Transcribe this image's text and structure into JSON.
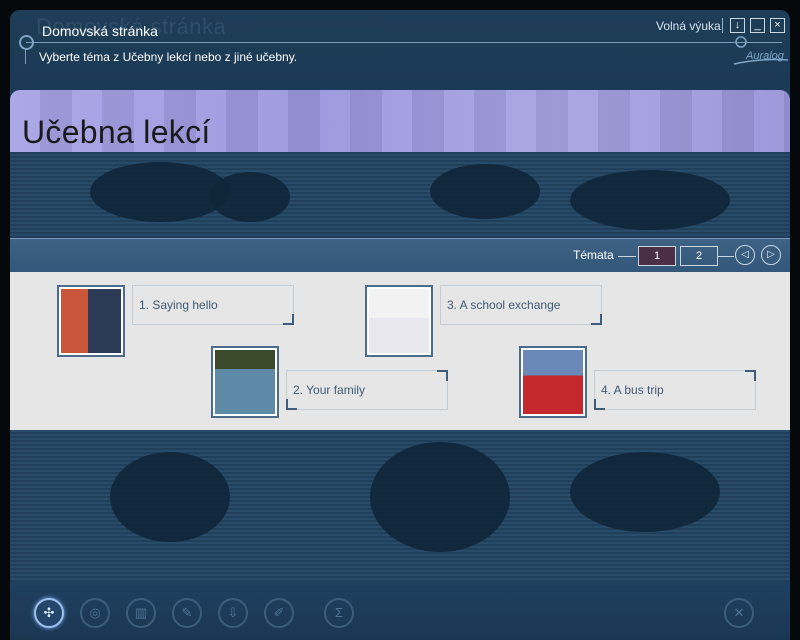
{
  "window": {
    "ghost_title": "Domovská stránka",
    "title": "Domovská stránka",
    "subtitle": "Vyberte téma z Učebny lekcí nebo z jiné učebny.",
    "mode_label": "Volná výuka",
    "buttons": {
      "download": "↓",
      "minimize": "_",
      "close": "×"
    },
    "logo_text": "Auralog"
  },
  "section": {
    "title": "Učebna lekcí"
  },
  "topics": {
    "label": "Témata",
    "pages": [
      "1",
      "2"
    ],
    "active_page": "1",
    "prev_icon": "◁",
    "next_icon": "▷"
  },
  "lessons": [
    {
      "label": "1. Saying hello",
      "icon": "handshake-photo"
    },
    {
      "label": "2. Your family",
      "icon": "family-photo"
    },
    {
      "label": "3. A school exchange",
      "icon": "student-photo"
    },
    {
      "label": "4. A bus trip",
      "icon": "london-bus-photo"
    }
  ],
  "toolbar": {
    "tools": [
      {
        "name": "lessons-tool",
        "glyph": "✣",
        "active": true
      },
      {
        "name": "tool-2",
        "glyph": "◎",
        "active": false
      },
      {
        "name": "tool-3",
        "glyph": "▥",
        "active": false
      },
      {
        "name": "tool-4",
        "glyph": "✎",
        "active": false
      },
      {
        "name": "tool-5",
        "glyph": "⇩",
        "active": false
      },
      {
        "name": "tool-6",
        "glyph": "✐",
        "active": false
      },
      {
        "name": "tool-7",
        "glyph": "Σ",
        "active": false
      },
      {
        "name": "tool-exit",
        "glyph": "✕",
        "active": false
      }
    ]
  },
  "colors": {
    "accent": "#4a2f45",
    "panel": "#e6e6e6",
    "frame": "#1d3c56"
  }
}
